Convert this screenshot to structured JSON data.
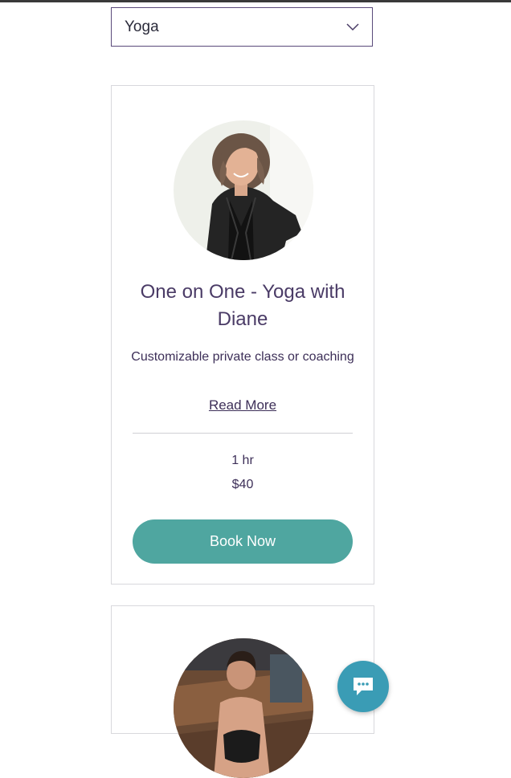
{
  "filter": {
    "selected": "Yoga"
  },
  "services": [
    {
      "title": "One on One - Yoga with Diane",
      "description": "Customizable private class or coaching",
      "read_more": "Read More",
      "duration": "1 hr",
      "price": "$40",
      "book_label": "Book Now"
    }
  ],
  "colors": {
    "accent": "#4fa6a0",
    "text": "#3d2f58",
    "chat": "#3a9cb5"
  },
  "icons": {
    "dropdown": "chevron-down-icon",
    "chat": "chat-bubble-icon"
  }
}
